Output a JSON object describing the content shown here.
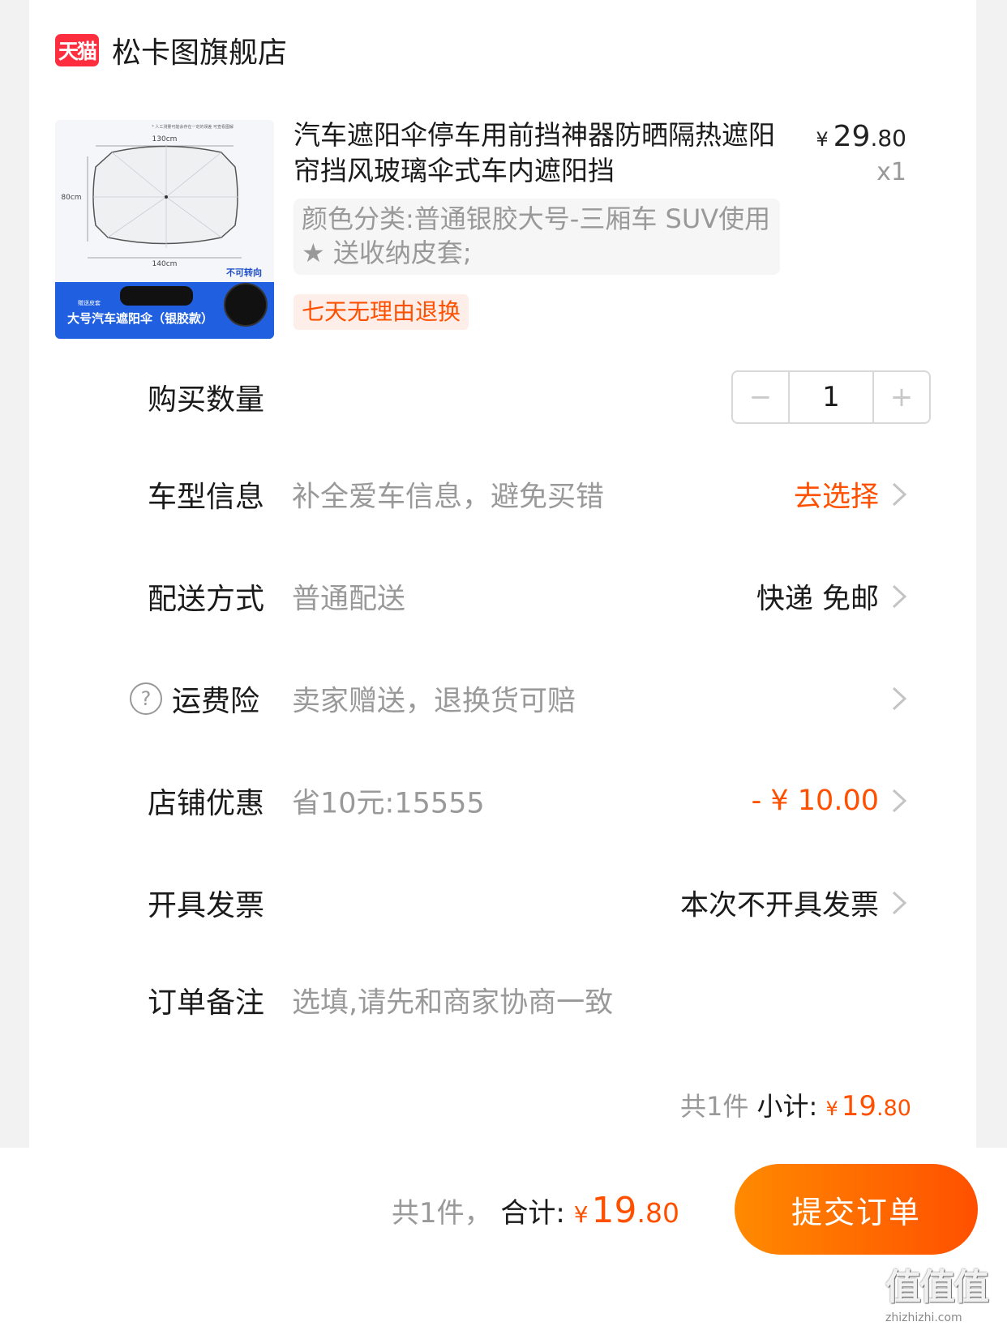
{
  "shop": {
    "logo_text": "天猫",
    "name": "松卡图旗舰店"
  },
  "product": {
    "title": "汽车遮阳伞停车用前挡神器防晒隔热遮阳帘挡风玻璃伞式车内遮阳挡",
    "price_symbol": "¥",
    "price_int": "29",
    "price_dec": ".80",
    "quantity_mult": "x1",
    "sku": "颜色分类:普通银胶大号-三厢车 SUV使用 ★ 送收纳皮套;",
    "return_tag": "七天无理由退换",
    "image": {
      "dim_top": "130cm",
      "dim_bottom": "140cm",
      "dim_left": "80cm",
      "note_top": "* 人工测量可能会存在一定的误差 可查看图解",
      "label_no_turn": "不可转向",
      "label_gift": "赠送皮套",
      "banner": "大号汽车遮阳伞（银胶款）"
    }
  },
  "rows": {
    "quantity": {
      "label": "购买数量",
      "minus": "−",
      "value": "1",
      "plus": "+"
    },
    "car_model": {
      "label": "车型信息",
      "desc": "补全爱车信息，避免买错",
      "value": "去选择"
    },
    "delivery": {
      "label": "配送方式",
      "desc": "普通配送",
      "value": "快递 免邮"
    },
    "shipping_insurance": {
      "label": "运费险",
      "desc": "卖家赠送，退换货可赔",
      "help": "?"
    },
    "shop_discount": {
      "label": "店铺优惠",
      "desc": "省10元:15555",
      "value": "- ¥ 10.00"
    },
    "invoice": {
      "label": "开具发票",
      "value": "本次不开具发票"
    },
    "remark": {
      "label": "订单备注",
      "placeholder": "选填,请先和商家协商一致"
    }
  },
  "subtotal": {
    "count_text": "共1件",
    "label": "小计:",
    "symbol": "¥",
    "int": "19",
    "dec": ".80"
  },
  "footer": {
    "count_text": "共1件，",
    "label": "合计:",
    "symbol": "¥",
    "int": "19",
    "dec": ".80",
    "submit_label": "提交订单"
  },
  "watermark": {
    "big": "值值值",
    "small": "zhizhizhi.com"
  },
  "colors": {
    "accent": "#ff5000",
    "muted": "#999999",
    "tmall_red": "#ff2e3e"
  }
}
